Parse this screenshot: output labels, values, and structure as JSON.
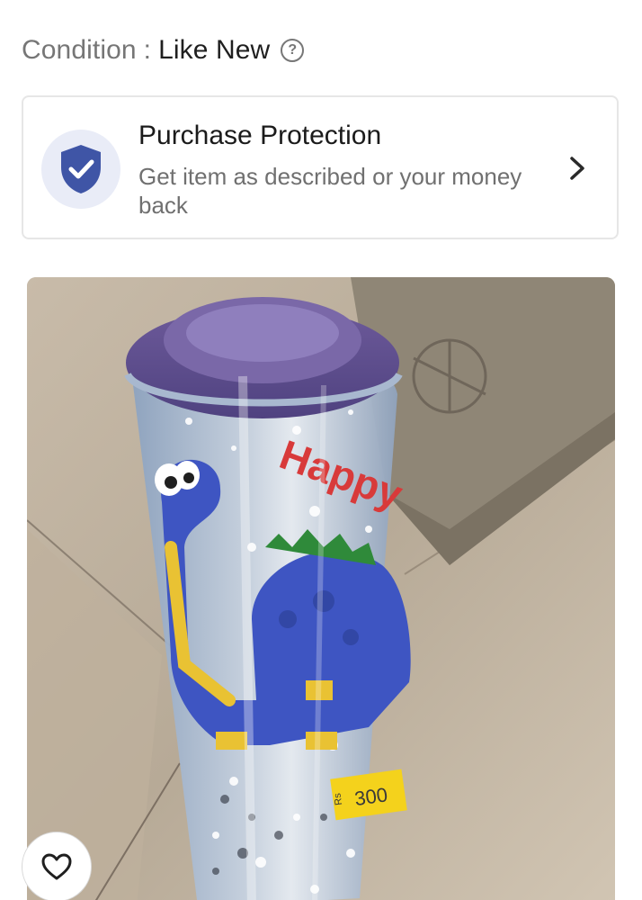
{
  "condition": {
    "label": "Condition",
    "separator": ":",
    "value": "Like New",
    "help_icon": "help-circle-icon",
    "help_glyph": "?"
  },
  "protection": {
    "title": "Purchase Protection",
    "description": "Get item as described or your money back",
    "shield_icon": "shield-check-icon",
    "chevron_icon": "chevron-right-icon",
    "shield_color": "#3f55a6"
  },
  "product_photo": {
    "printed_text": "Happy",
    "price_tag": "300",
    "price_tag_currency": "Rs"
  },
  "favorite": {
    "icon": "heart-outline-icon"
  },
  "colors": {
    "accent": "#3f55a6",
    "card_border": "#e6e6e6",
    "muted_text": "#767676"
  }
}
